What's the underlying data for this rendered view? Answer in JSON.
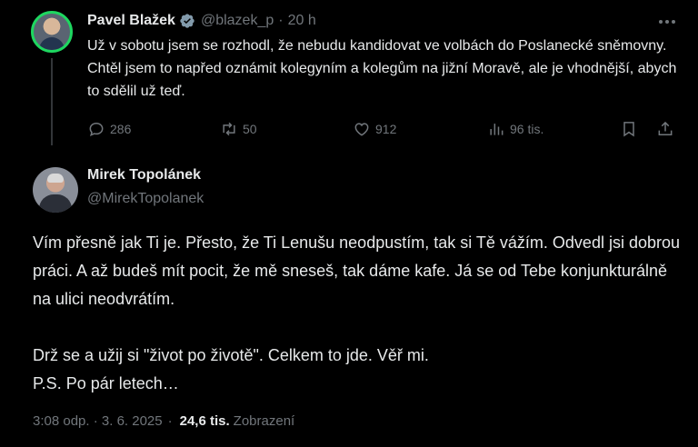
{
  "parent_tweet": {
    "author_name": "Pavel Blažek",
    "handle": "@blazek_p",
    "separator": "·",
    "time": "20 h",
    "text": "Už v sobotu jsem se rozhodl, že nebudu kandidovat ve volbách do Poslanecké sněmovny. Chtěl jsem to napřed oznámit kolegyním a kolegům na jižní Moravě, ale je vhodnější, abych to sdělil už teď.",
    "replies": "286",
    "reposts": "50",
    "likes": "912",
    "views": "96 tis.",
    "icons": {
      "verified": "verified-badge-icon",
      "more": "more-icon",
      "reply": "reply-icon",
      "repost": "repost-icon",
      "like": "heart-icon",
      "views": "views-icon",
      "bookmark": "bookmark-icon",
      "share": "share-icon"
    },
    "colors": {
      "verified": "#829aab",
      "avatar_ring": "#1ed760"
    }
  },
  "main_tweet": {
    "author_name": "Mirek Topolánek",
    "handle": "@MirekTopolanek",
    "paragraphs": [
      "Vím přesně jak Ti je. Přesto, že Ti Lenušu neodpustím, tak si Tě vážím. Odvedl jsi dobrou práci. A až budeš mít pocit, že mě sneseš, tak dáme kafe. Já se od Tebe konjunkturálně na ulici neodvrátím.",
      "Drž se a užij si \"život po životě\". Celkem to jde. Věř mi.",
      "P.S. Po pár letech…"
    ],
    "timestamp": "3:08 odp. · 3. 6. 2025",
    "meta_separator": "·",
    "views_count": "24,6 tis.",
    "views_label": "Zobrazení"
  },
  "theme": {
    "background": "#000000",
    "text": "#e7e9ea",
    "muted": "#71767b",
    "divider": "#333639"
  }
}
